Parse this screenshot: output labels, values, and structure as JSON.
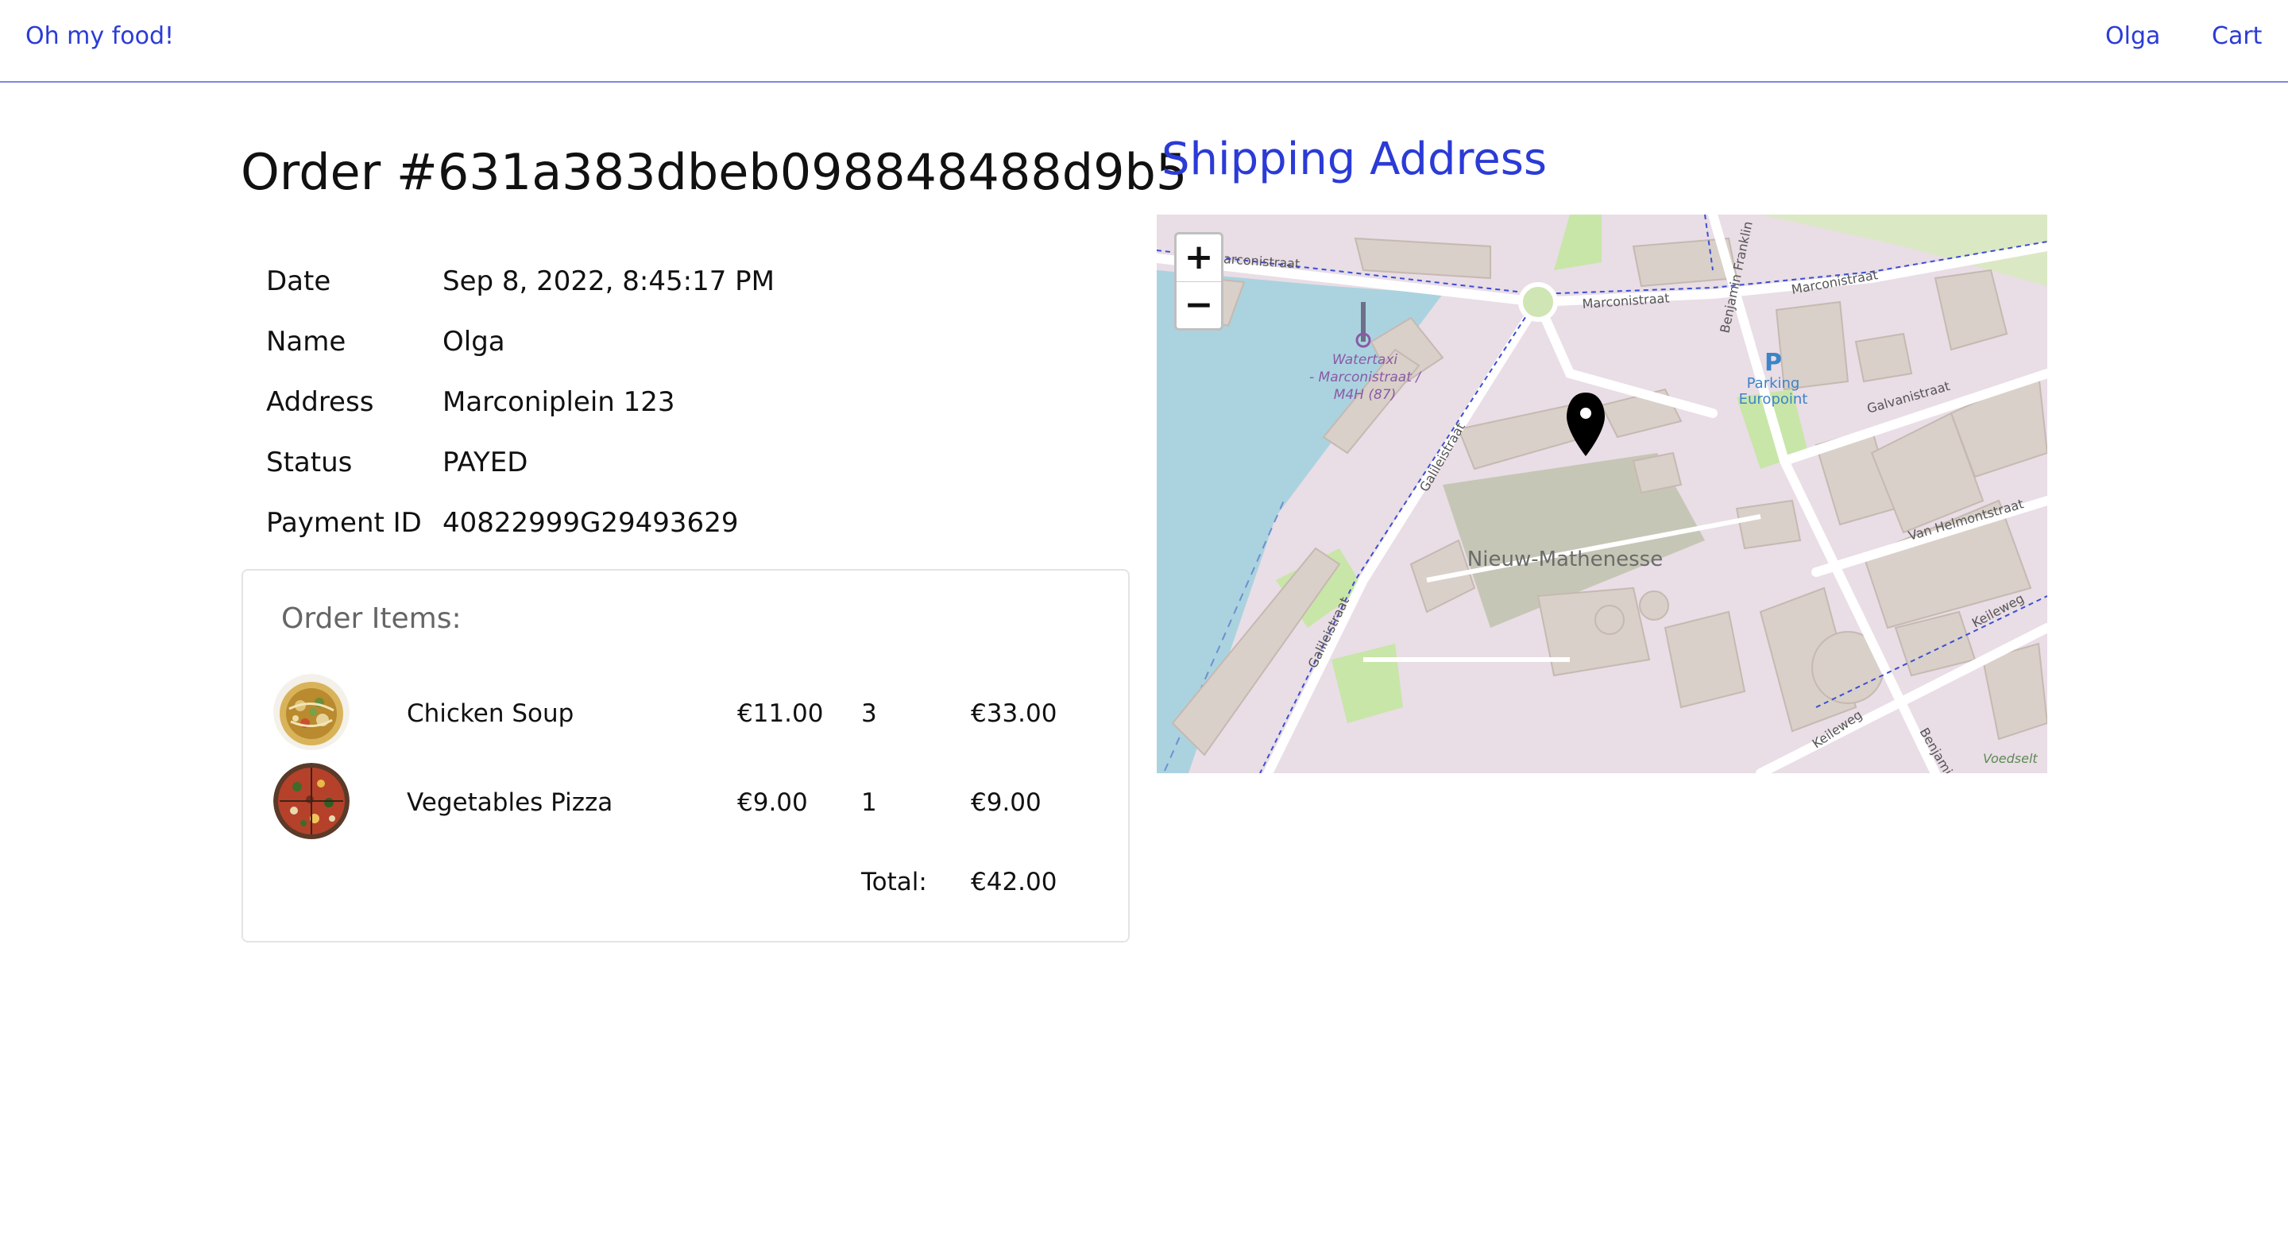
{
  "header": {
    "brand": "Oh my food!",
    "user": "Olga",
    "cart": "Cart"
  },
  "order": {
    "title": "Order #631a383dbeb098848488d9b5",
    "details": [
      {
        "label": "Date",
        "value": "Sep 8, 2022, 8:45:17 PM"
      },
      {
        "label": "Name",
        "value": "Olga"
      },
      {
        "label": "Address",
        "value": "Marconiplein 123"
      },
      {
        "label": "Status",
        "value": "PAYED"
      },
      {
        "label": "Payment ID",
        "value": "40822999G29493629"
      }
    ]
  },
  "items": {
    "heading": "Order Items:",
    "rows": [
      {
        "name": "Chicken Soup",
        "price": "€11.00",
        "qty": "3",
        "subtotal": "€33.00",
        "image": "chicken-soup-photo"
      },
      {
        "name": "Vegetables Pizza",
        "price": "€9.00",
        "qty": "1",
        "subtotal": "€9.00",
        "image": "vegetables-pizza-photo"
      }
    ],
    "total_label": "Total:",
    "total_value": "€42.00"
  },
  "shipping": {
    "title": "Shipping Address",
    "zoom_in": "+",
    "zoom_out": "−",
    "map_labels": {
      "district": "Nieuw-Mathenesse",
      "marconistraat_a": "Marconistraat",
      "marconistraat_b": "Marconistraat",
      "marconistraat_c": "Marconistraat",
      "benjamin": "Benjamin Franklin",
      "galileistraat_a": "Galileistraat",
      "galileistraat_b": "Galileistraat",
      "galvanistraat": "Galvanistraat",
      "van_helmont": "Van Helmontstraat",
      "keileweg_a": "Keileweg",
      "keileweg_b": "Keileweg",
      "watertaxi_1": "Watertaxi",
      "watertaxi_2": "- Marconistraat /",
      "watertaxi_3": "M4H (87)",
      "parking_p": "P",
      "parking_1": "Parking",
      "parking_2": "Europoint",
      "voedsel": "Voedselt",
      "benjamin_b": "Benjamin"
    }
  },
  "colors": {
    "brand": "#2b3bd6",
    "map_land": "#e9dde6",
    "map_water": "#aad3df",
    "map_building": "#d9d0c9",
    "map_green": "#c8e6a8"
  }
}
